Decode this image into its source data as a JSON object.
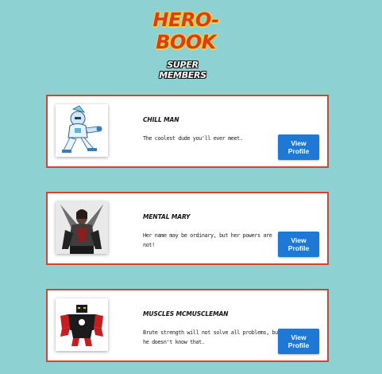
{
  "header": {
    "logo": "HERO-BOOK",
    "section_title": "SUPER MEMBERS"
  },
  "members": [
    {
      "name": "CHILL MAN",
      "description": "The coolest dude you'll ever meet.",
      "button_label": "View Profile",
      "image": "chill-man-avatar"
    },
    {
      "name": "MENTAL MARY",
      "description": "Her name may be ordinary, but her powers are not!",
      "button_label": "View Profile",
      "image": "mental-mary-avatar"
    },
    {
      "name": "MUSCLES MCMUSCLEMAN",
      "description": "Brute strength will not solve all problems, but he doesn't know that.",
      "button_label": "View Profile",
      "image": "muscles-mcmuscleman-avatar"
    }
  ],
  "colors": {
    "background": "#8ed1d2",
    "card_border": "#d04431",
    "button": "#1e78d6",
    "logo": "#e03a1c",
    "logo_outline": "#f2d23a"
  }
}
